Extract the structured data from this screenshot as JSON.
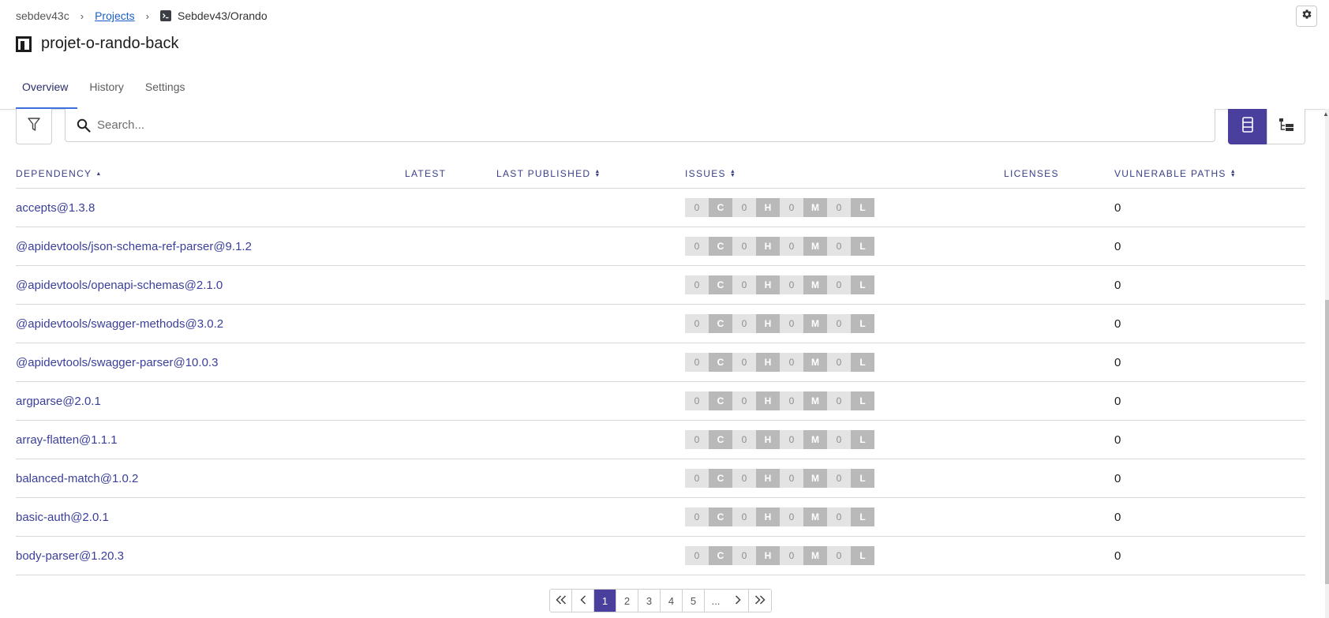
{
  "breadcrumb": {
    "org": "sebdev43c",
    "projects_link": "Projects",
    "repo": "Sebdev43/Orando"
  },
  "project": {
    "title": "projet-o-rando-back"
  },
  "tabs": [
    {
      "label": "Overview",
      "active": true
    },
    {
      "label": "History",
      "active": false
    },
    {
      "label": "Settings",
      "active": false
    }
  ],
  "search": {
    "placeholder": "Search...",
    "value": ""
  },
  "view_toggle": {
    "selected": "list",
    "options": [
      "list-icon",
      "tree-icon"
    ]
  },
  "table": {
    "headers": {
      "dependency": "DEPENDENCY",
      "latest": "LATEST",
      "last_published": "LAST PUBLISHED",
      "issues": "ISSUES",
      "licenses": "LICENSES",
      "vulnerable_paths": "VULNERABLE PATHS"
    },
    "severity_letters": [
      "C",
      "H",
      "M",
      "L"
    ],
    "rows": [
      {
        "dependency": "accepts@1.3.8",
        "latest": "",
        "last_published": "",
        "c": "0",
        "h": "0",
        "m": "0",
        "l": "0",
        "licenses": "",
        "vulnerable_paths": "0"
      },
      {
        "dependency": "@apidevtools/json-schema-ref-parser@9.1.2",
        "latest": "",
        "last_published": "",
        "c": "0",
        "h": "0",
        "m": "0",
        "l": "0",
        "licenses": "",
        "vulnerable_paths": "0"
      },
      {
        "dependency": "@apidevtools/openapi-schemas@2.1.0",
        "latest": "",
        "last_published": "",
        "c": "0",
        "h": "0",
        "m": "0",
        "l": "0",
        "licenses": "",
        "vulnerable_paths": "0"
      },
      {
        "dependency": "@apidevtools/swagger-methods@3.0.2",
        "latest": "",
        "last_published": "",
        "c": "0",
        "h": "0",
        "m": "0",
        "l": "0",
        "licenses": "",
        "vulnerable_paths": "0"
      },
      {
        "dependency": "@apidevtools/swagger-parser@10.0.3",
        "latest": "",
        "last_published": "",
        "c": "0",
        "h": "0",
        "m": "0",
        "l": "0",
        "licenses": "",
        "vulnerable_paths": "0"
      },
      {
        "dependency": "argparse@2.0.1",
        "latest": "",
        "last_published": "",
        "c": "0",
        "h": "0",
        "m": "0",
        "l": "0",
        "licenses": "",
        "vulnerable_paths": "0"
      },
      {
        "dependency": "array-flatten@1.1.1",
        "latest": "",
        "last_published": "",
        "c": "0",
        "h": "0",
        "m": "0",
        "l": "0",
        "licenses": "",
        "vulnerable_paths": "0"
      },
      {
        "dependency": "balanced-match@1.0.2",
        "latest": "",
        "last_published": "",
        "c": "0",
        "h": "0",
        "m": "0",
        "l": "0",
        "licenses": "",
        "vulnerable_paths": "0"
      },
      {
        "dependency": "basic-auth@2.0.1",
        "latest": "",
        "last_published": "",
        "c": "0",
        "h": "0",
        "m": "0",
        "l": "0",
        "licenses": "",
        "vulnerable_paths": "0"
      },
      {
        "dependency": "body-parser@1.20.3",
        "latest": "",
        "last_published": "",
        "c": "0",
        "h": "0",
        "m": "0",
        "l": "0",
        "licenses": "",
        "vulnerable_paths": "0"
      }
    ]
  },
  "pagination": {
    "pages": [
      "1",
      "2",
      "3",
      "4",
      "5",
      "..."
    ],
    "current": "1"
  },
  "colors": {
    "accent": "#4a3f9c",
    "link": "#3a3f9a",
    "tab_underline": "#3d6fdd",
    "severity_letter_bg": "#b9b9b9",
    "severity_count_bg": "#e3e3e3"
  }
}
